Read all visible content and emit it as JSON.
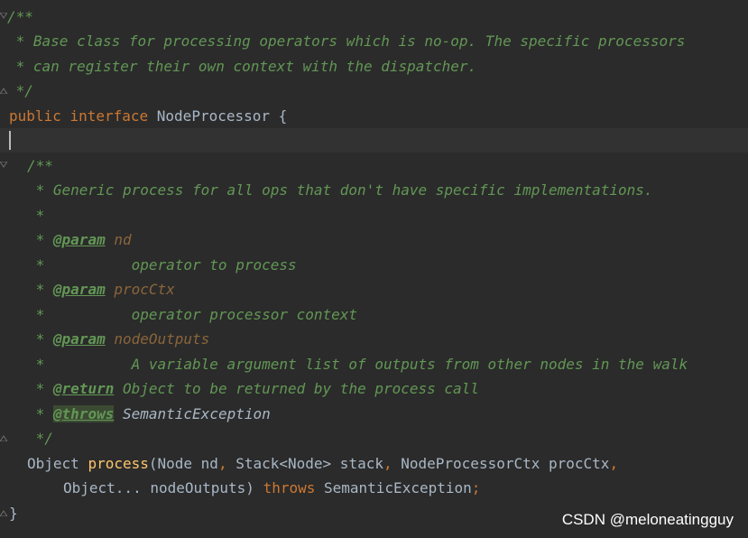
{
  "editor": {
    "lines": {
      "l1": {
        "t1": "/**"
      },
      "l2": {
        "t1": " * Base class for processing operators which is no-op. The specific processors"
      },
      "l3": {
        "t1": " * can register their own context with the dispatcher."
      },
      "l4": {
        "t1": " */"
      },
      "l5": {
        "kw1": "public",
        "kw2": "interface",
        "name": "NodeProcessor",
        "brace": "{"
      },
      "l7": {
        "t1": "/**"
      },
      "l8": {
        "t1": " * Generic process for all ops that don't have specific implementations."
      },
      "l9": {
        "t1": " *"
      },
      "l10": {
        "star": " * ",
        "tag": "@param",
        "pname": "nd"
      },
      "l11": {
        "t1": " *          operator to process"
      },
      "l12": {
        "star": " * ",
        "tag": "@param",
        "pname": "procCtx"
      },
      "l13": {
        "t1": " *          operator processor context"
      },
      "l14": {
        "star": " * ",
        "tag": "@param",
        "pname": "nodeOutputs"
      },
      "l15": {
        "t1": " *          A variable argument list of outputs from other nodes in the walk"
      },
      "l16": {
        "star": " * ",
        "tag": "@return",
        "desc": "Object to be returned by the process call"
      },
      "l17": {
        "star": " * ",
        "tag": "@throws",
        "exc": "SemanticException"
      },
      "l18": {
        "t1": " */"
      },
      "l19": {
        "a": "Object ",
        "fn": "process",
        "b": "(Node nd",
        "c1": ",",
        "d": " Stack<Node> stack",
        "c2": ",",
        "e": " NodeProcessorCtx procCtx",
        "c3": ","
      },
      "l20": {
        "a": "Object... nodeOutputs) ",
        "kw": "throws",
        "b": " SemanticException",
        "semi": ";"
      },
      "l21": {
        "t1": "}"
      }
    }
  },
  "watermark": "CSDN @meloneatingguy",
  "colors": {
    "background": "#2b2b2b",
    "doc_comment": "#629755",
    "keyword": "#cc7832",
    "identifier": "#a9b7c6",
    "method": "#ffc66d",
    "param_name": "#8a653b"
  }
}
